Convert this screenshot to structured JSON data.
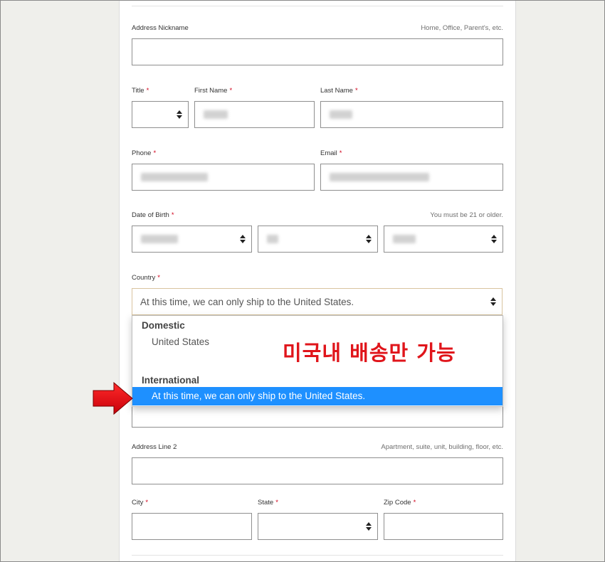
{
  "form": {
    "address_nickname": {
      "label": "Address Nickname",
      "hint": "Home, Office, Parent's, etc.",
      "value": ""
    },
    "title": {
      "label": "Title",
      "required_mark": "*",
      "value": ""
    },
    "first_name": {
      "label": "First Name",
      "required_mark": "*"
    },
    "last_name": {
      "label": "Last Name",
      "required_mark": "*"
    },
    "phone": {
      "label": "Phone",
      "required_mark": "*"
    },
    "email": {
      "label": "Email",
      "required_mark": "*"
    },
    "date_of_birth": {
      "label": "Date of Birth",
      "required_mark": "*",
      "hint": "You must be 21 or older."
    },
    "country": {
      "label": "Country",
      "required_mark": "*",
      "value": "At this time, we can only ship to the United States.",
      "dropdown": {
        "groups": [
          {
            "label": "Domestic",
            "options": [
              "United States"
            ]
          },
          {
            "label": "International",
            "options": [
              "At this time, we can only ship to the United States."
            ]
          }
        ],
        "selected": "At this time, we can only ship to the United States."
      }
    },
    "address_line_2": {
      "label": "Address Line 2",
      "hint": "Apartment, suite, unit, building, floor, etc.",
      "value": ""
    },
    "city": {
      "label": "City",
      "required_mark": "*",
      "value": ""
    },
    "state": {
      "label": "State",
      "required_mark": "*",
      "value": ""
    },
    "zip_code": {
      "label": "Zip Code",
      "required_mark": "*",
      "value": ""
    }
  },
  "annotation": {
    "text": "미국내 배송만 가능",
    "color": "#e0151b"
  },
  "colors": {
    "selected_option_bg": "#1e90ff",
    "required_mark": "#d0021b"
  }
}
